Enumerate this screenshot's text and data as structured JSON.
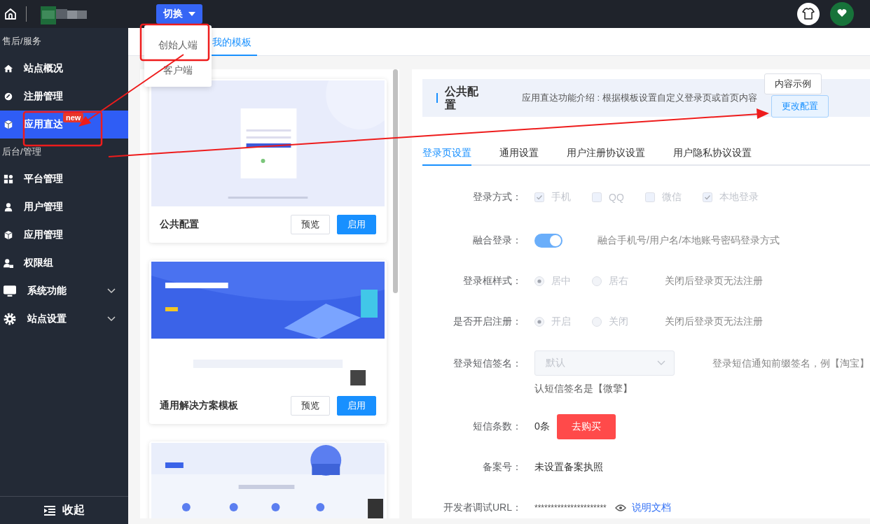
{
  "top_bar": {
    "switch_button": "切换",
    "switch_menu": [
      {
        "label": "创始人端"
      },
      {
        "label": "客户端"
      }
    ]
  },
  "sidebar": {
    "groups": [
      {
        "title": "售后/服务",
        "items": [
          {
            "label": "站点概况",
            "selected": false
          },
          {
            "label": "注册管理",
            "selected": false
          },
          {
            "label": "应用直达",
            "selected": true,
            "badge": "new"
          }
        ]
      },
      {
        "title": "后台/管理",
        "items": [
          {
            "label": "平台管理",
            "selected": false
          },
          {
            "label": "用户管理",
            "selected": false
          },
          {
            "label": "应用管理",
            "selected": false
          },
          {
            "label": "权限组",
            "selected": false
          },
          {
            "label": "系统功能",
            "selected": false,
            "expanded": false
          },
          {
            "label": "站点设置",
            "selected": false,
            "expanded": false
          }
        ]
      }
    ],
    "collapse": "收起"
  },
  "tabs": [
    {
      "label": "我的模板",
      "selected": true
    }
  ],
  "templates": [
    {
      "title": "公共配置",
      "buttons": [
        "预览",
        "启用"
      ]
    },
    {
      "title": "通用解决方案模板",
      "buttons": [
        "预览",
        "启用"
      ]
    },
    {
      "kind": "picture"
    }
  ],
  "config": {
    "title": "公共配置",
    "intro": "应用直达功能介绍 : 根据模板设置自定义登录页或首页内容",
    "buttons": [
      "内容示例",
      "更改配置"
    ],
    "tabs": [
      {
        "label": "登录页设置",
        "selected": true
      },
      {
        "label": "通用设置",
        "selected": false
      },
      {
        "label": "用户注册协议设置",
        "selected": false
      },
      {
        "label": "用户隐私协议设置",
        "selected": false
      }
    ],
    "rows": [
      {
        "kind": "checks",
        "label": "登录方式：",
        "disabled": true,
        "options": [
          {
            "label": "手机",
            "checked": true
          },
          {
            "label": "QQ",
            "checked": false
          },
          {
            "label": "微信",
            "checked": false
          },
          {
            "label": "本地登录",
            "checked": true
          }
        ]
      },
      {
        "kind": "switch",
        "label": "融合登录：",
        "on": true,
        "hint": "融合手机号/用户名/本地账号密码登录方式"
      },
      {
        "kind": "radio",
        "label": "登录框样式：",
        "disabled": true,
        "options": [
          {
            "label": "居中",
            "selected": true
          },
          {
            "label": "居右",
            "selected": false
          }
        ],
        "hint": "关闭后登录页无法注册"
      },
      {
        "kind": "radio",
        "label": "是否开启注册：",
        "disabled": true,
        "options": [
          {
            "label": "开启",
            "selected": true
          },
          {
            "label": "关闭",
            "selected": false
          }
        ],
        "hint": "关闭后登录页无法注册"
      },
      {
        "kind": "select",
        "label": "登录短信签名：",
        "value": "默认",
        "hint": "登录短信通知前缀签名，例【淘宝】",
        "hint_more": "认短信签名是【微擎】"
      },
      {
        "kind": "count",
        "label": "短信条数：",
        "value": "0条",
        "button": "去购买"
      },
      {
        "kind": "text",
        "label": "备案号：",
        "value": "未设置备案执照"
      },
      {
        "kind": "url",
        "label": "开发者调试URL：",
        "value": "**********************",
        "link": "说明文档"
      }
    ]
  }
}
